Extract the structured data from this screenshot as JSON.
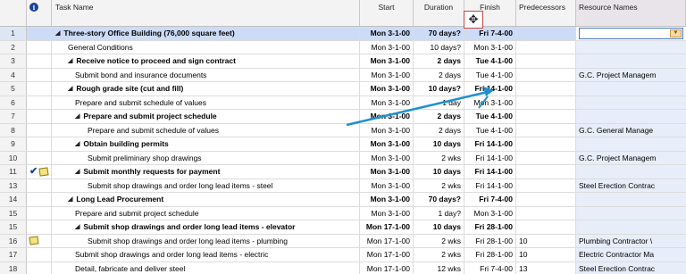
{
  "headers": {
    "indicator": "i",
    "task_name": "Task Name",
    "start": "Start",
    "duration": "Duration",
    "finish": "Finish",
    "predecessors": "Predecessors",
    "resource_names": "Resource Names"
  },
  "rows": [
    {
      "id": "1",
      "name": "Three-story Office Building (76,000 square feet)",
      "start": "Mon 3-1-00",
      "duration": "70 days?",
      "finish": "Fri 7-4-00",
      "pred": "",
      "res": ""
    },
    {
      "id": "2",
      "name": "General Conditions",
      "start": "Mon 3-1-00",
      "duration": "10 days?",
      "finish": "Mon 3-1-00",
      "pred": "",
      "res": ""
    },
    {
      "id": "3",
      "name": "Receive notice to proceed and sign contract",
      "start": "Mon 3-1-00",
      "duration": "2 days",
      "finish": "Tue 4-1-00",
      "pred": "",
      "res": ""
    },
    {
      "id": "4",
      "name": "Submit bond and insurance documents",
      "start": "Mon 3-1-00",
      "duration": "2 days",
      "finish": "Tue 4-1-00",
      "pred": "",
      "res": "G.C. Project Managem"
    },
    {
      "id": "5",
      "name": "Rough grade site (cut and fill)",
      "start": "Mon 3-1-00",
      "duration": "10 days?",
      "finish": "Fri 14-1-00",
      "pred": "",
      "res": ""
    },
    {
      "id": "6",
      "name": "Prepare and submit schedule of values",
      "start": "Mon 3-1-00",
      "duration": "1 day",
      "finish": "Mon 3-1-00",
      "pred": "",
      "res": ""
    },
    {
      "id": "7",
      "name": "Prepare and submit project schedule",
      "start": "Mon 3-1-00",
      "duration": "2 days",
      "finish": "Tue 4-1-00",
      "pred": "",
      "res": ""
    },
    {
      "id": "8",
      "name": "Prepare and submit schedule of values",
      "start": "Mon 3-1-00",
      "duration": "2 days",
      "finish": "Tue 4-1-00",
      "pred": "",
      "res": "G.C. General Manage"
    },
    {
      "id": "9",
      "name": "Obtain building permits",
      "start": "Mon 3-1-00",
      "duration": "10 days",
      "finish": "Fri 14-1-00",
      "pred": "",
      "res": ""
    },
    {
      "id": "10",
      "name": "Submit preliminary shop drawings",
      "start": "Mon 3-1-00",
      "duration": "2 wks",
      "finish": "Fri 14-1-00",
      "pred": "",
      "res": "G.C. Project Managem"
    },
    {
      "id": "11",
      "name": "Submit monthly requests for payment",
      "start": "Mon 3-1-00",
      "duration": "10 days",
      "finish": "Fri 14-1-00",
      "pred": "",
      "res": ""
    },
    {
      "id": "13",
      "name": "Submit shop drawings and order long lead items - steel",
      "start": "Mon 3-1-00",
      "duration": "2 wks",
      "finish": "Fri 14-1-00",
      "pred": "",
      "res": "Steel Erection Contrac"
    },
    {
      "id": "14",
      "name": "Long Lead Procurement",
      "start": "Mon 3-1-00",
      "duration": "70 days?",
      "finish": "Fri 7-4-00",
      "pred": "",
      "res": ""
    },
    {
      "id": "15",
      "name": "Prepare and submit project schedule",
      "start": "Mon 3-1-00",
      "duration": "1 day?",
      "finish": "Mon 3-1-00",
      "pred": "",
      "res": ""
    },
    {
      "id": "15",
      "name": "Submit shop drawings and order long lead items - elevator",
      "start": "Mon 17-1-00",
      "duration": "10 days",
      "finish": "Fri 28-1-00",
      "pred": "",
      "res": ""
    },
    {
      "id": "16",
      "name": "Submit shop drawings and order long lead items - plumbing",
      "start": "Mon 17-1-00",
      "duration": "2 wks",
      "finish": "Fri 28-1-00",
      "pred": "10",
      "res": "Plumbing Contractor \\"
    },
    {
      "id": "17",
      "name": "Submit shop drawings and order long lead items - electric",
      "start": "Mon 17-1-00",
      "duration": "2 wks",
      "finish": "Fri 28-1-00",
      "pred": "10",
      "res": "Electric Contractor Ma"
    },
    {
      "id": "18",
      "name": "Detail, fabricate and deliver steel",
      "start": "Mon 17-1-00",
      "duration": "12 wks",
      "finish": "Fri 7-4-00",
      "pred": "13",
      "res": "Steel Erection Contrac"
    }
  ],
  "colors": {
    "selected_row": "#ccdcf7",
    "arrow": "#1f8fd0",
    "resource_tint": "#e7edf9"
  },
  "icons": {
    "indicator_header": "info-icon",
    "row11": [
      "checkmark-icon",
      "note-icon"
    ],
    "row16": [
      "note-icon"
    ],
    "resource_dropdown": "chevron-down-icon",
    "cursor": "move-cursor-icon"
  }
}
